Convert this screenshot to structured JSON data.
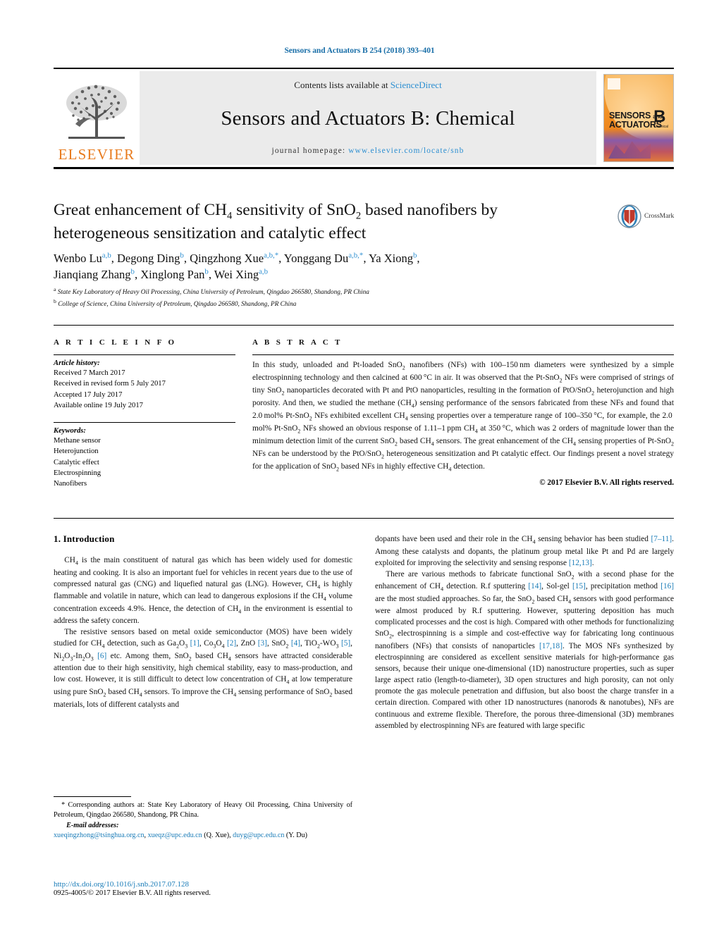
{
  "running_head": "Sensors and Actuators B 254 (2018) 393–401",
  "masthead": {
    "contents_prefix": "Contents lists available at ",
    "contents_link": "ScienceDirect",
    "journal_title": "Sensors and Actuators B: Chemical",
    "homepage_prefix": "journal homepage: ",
    "homepage_url": "www.elsevier.com/locate/snb",
    "publisher": "ELSEVIER",
    "cover": {
      "line1": "SENSORS",
      "line1_and": "and",
      "line2": "ACTUATORS",
      "volume_letter": "B",
      "volume_sub": "Chemical"
    }
  },
  "crossmark": {
    "label": "CrossMark"
  },
  "article": {
    "title_line1_a": "Great enhancement of CH",
    "title_sub1": "4",
    "title_line1_b": " sensitivity of SnO",
    "title_sub2": "2",
    "title_line1_c": " based nanofibers by",
    "title_line2": "heterogeneous sensitization and catalytic effect",
    "authors_html": "Wenbo Lu, Degong Ding, Qingzhong Xue, Yonggang Du, Ya Xiong, Jianqiang Zhang, Xinglong Pan, Wei Xing",
    "affiliation_a": "State Key Laboratory of Heavy Oil Processing, China University of Petroleum, Qingdao 266580, Shandong, PR China",
    "affiliation_b": "College of Science, China University of Petroleum, Qingdao 266580, Shandong, PR China",
    "affiliation_a_marker": "a",
    "affiliation_b_marker": "b"
  },
  "article_info": {
    "heading": "A R T I C L E   I N F O",
    "history_label": "Article history:",
    "history": [
      "Received 7 March 2017",
      "Received in revised form 5 July 2017",
      "Accepted 17 July 2017",
      "Available online 19 July 2017"
    ],
    "keywords_label": "Keywords:",
    "keywords": [
      "Methane sensor",
      "Heterojunction",
      "Catalytic effect",
      "Electrospinning",
      "Nanofibers"
    ]
  },
  "abstract": {
    "heading": "A B S T R A C T",
    "copyright": "© 2017 Elsevier B.V. All rights reserved."
  },
  "introduction": {
    "heading": "1.  Introduction"
  },
  "footnote": {
    "corresponding": "* Corresponding authors at: State Key Laboratory of Heavy Oil Processing, China University of Petroleum, Qingdao 266580, Shandong, PR China.",
    "email_label": "E-mail addresses:",
    "email1": "xueqingzhong@tsinghua.org.cn",
    "email2": "xueqz@upc.edu.cn",
    "email1_owner": " (Q. Xue), ",
    "email3": "duyg@upc.edu.cn",
    "email3_owner": " (Y. Du)",
    "doi": "http://dx.doi.org/10.1016/j.snb.2017.07.128",
    "issn": "0925-4005/© 2017 Elsevier B.V. All rights reserved."
  },
  "colors": {
    "link": "#1a7cb8",
    "elsevier_orange": "#E87B1E",
    "masthead_band": "#ebebeb"
  }
}
